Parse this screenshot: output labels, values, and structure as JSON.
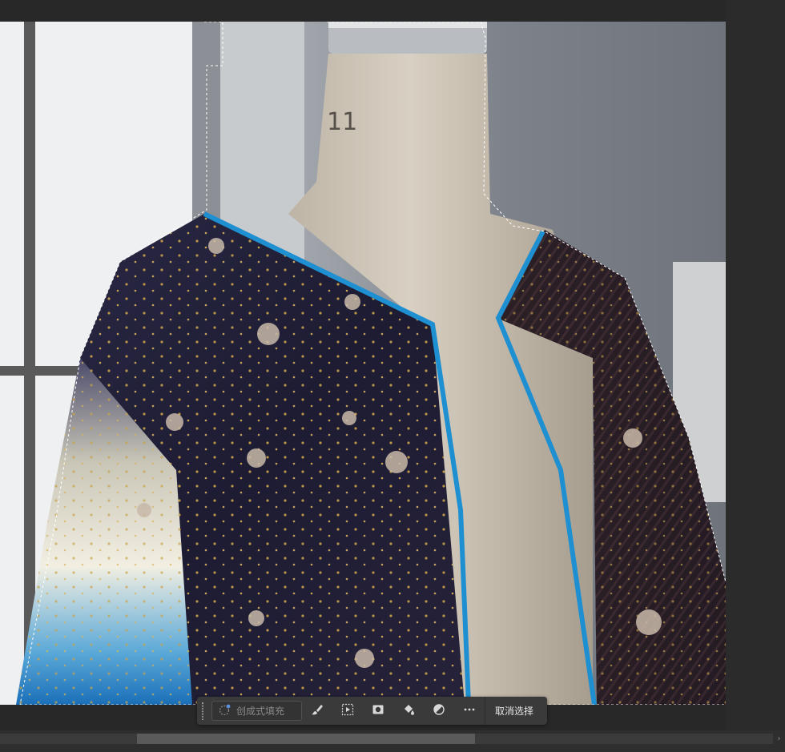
{
  "canvas": {
    "image_subject": "dress-form-with-floral-sheer-jacket",
    "selection_active": true
  },
  "contextual_taskbar": {
    "generative_fill_label": "创成式填充",
    "tools": [
      {
        "name": "brush-icon"
      },
      {
        "name": "select-subject-icon"
      },
      {
        "name": "mask-icon"
      },
      {
        "name": "paint-bucket-icon"
      },
      {
        "name": "adjustment-icon"
      },
      {
        "name": "more-icon"
      }
    ],
    "deselect_label": "取消选择"
  },
  "colors": {
    "toolbar_bg": "#3a3a3a",
    "app_bg": "#282828",
    "piping_blue": "#1e8fd0"
  }
}
